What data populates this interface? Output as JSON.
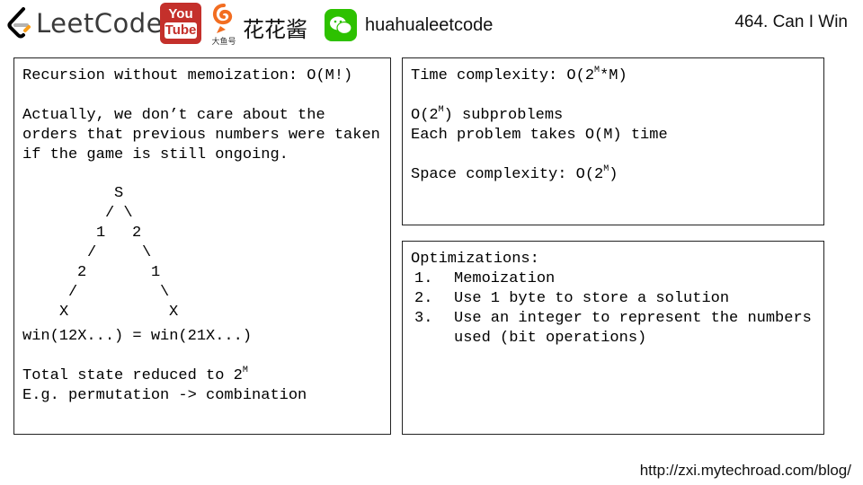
{
  "header": {
    "logo_text": "LeetCode",
    "youtube_top": "You",
    "youtube_bottom": "Tube",
    "douyu_label": "大鱼号",
    "brand_cn": "花花酱",
    "wechat_id": "huahualeetcode",
    "problem_title": "464. Can I Win"
  },
  "left_panel": {
    "line1": "Recursion without memoization: O(M!)",
    "line2": "Actually, we don’t care about the",
    "line3": "orders that previous numbers were taken",
    "line4": "if the game is still ongoing.",
    "tree": {
      "root": "S",
      "l1_edges": "/ \\",
      "n1": "1",
      "n2": "2",
      "e_left": "/",
      "e_right": "\\",
      "n3": "2",
      "n4": "1",
      "e_left2": "/",
      "e_right2": "\\",
      "leaf_left": "X",
      "leaf_right": "X"
    },
    "eq_line": "win(12X...) = win(21X...)",
    "reduced_prefix": "Total state reduced to 2",
    "reduced_sup": "M",
    "example_line": "E.g. permutation -> combination"
  },
  "top_right_panel": {
    "time_prefix": "Time complexity: O(2",
    "time_sup": "M",
    "time_suffix": "*M)",
    "sub_prefix": "O(2",
    "sub_sup": "M",
    "sub_suffix": ") subproblems",
    "each_line": "Each problem takes O(M) time",
    "space_prefix": "Space complexity: O(2",
    "space_sup": "M",
    "space_suffix": ")"
  },
  "bottom_right_panel": {
    "heading": "Optimizations:",
    "items": [
      {
        "num": "1.",
        "text": "Memoization"
      },
      {
        "num": "2.",
        "text": "Use 1 byte to store a solution"
      },
      {
        "num": "3.",
        "text": "Use an integer to represent the numbers used (bit operations)"
      }
    ]
  },
  "footer": {
    "url": "http://zxi.mytechroad.com/blog/"
  },
  "colors": {
    "youtube_red": "#c4302b",
    "wechat_green": "#2dc100",
    "leetcode_orange": "#f89f1b",
    "douyu_orange": "#f26d21"
  }
}
